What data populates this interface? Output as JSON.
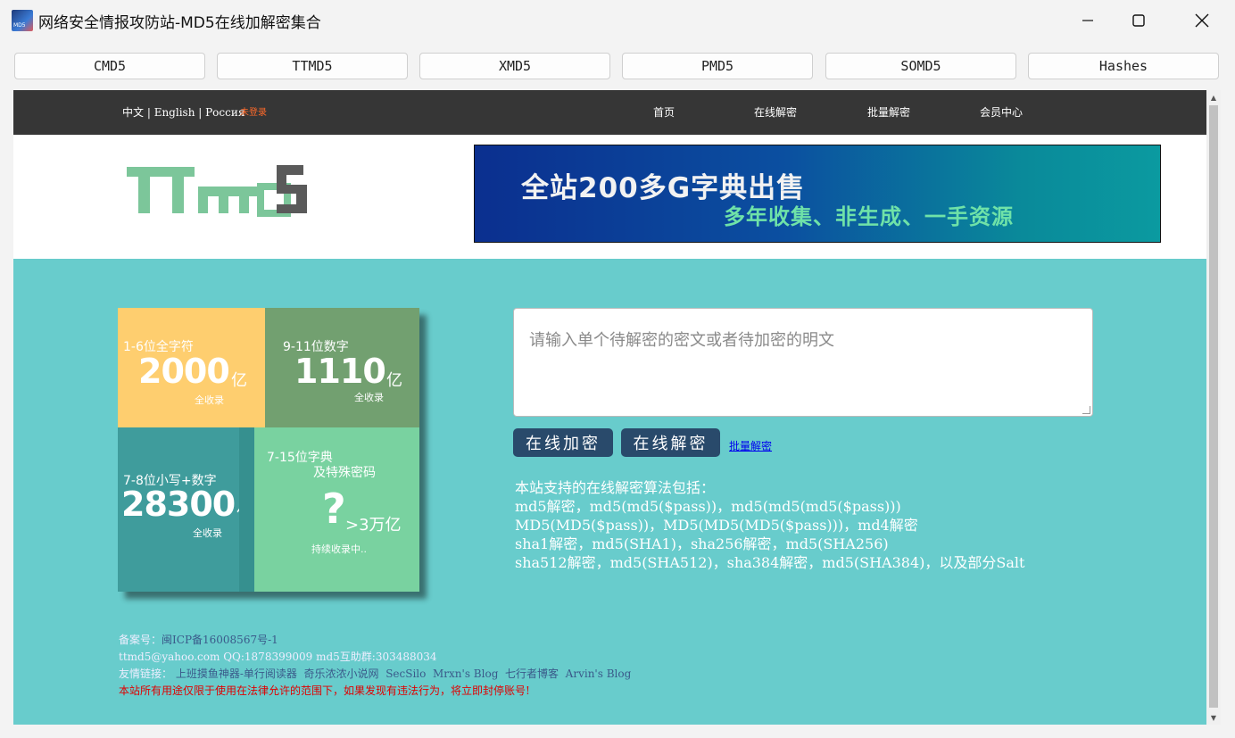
{
  "window": {
    "title": "网络安全情报攻防站-MD5在线加解密集合",
    "icon_label": "MD5"
  },
  "toolbar": {
    "buttons": [
      "CMD5",
      "TTMD5",
      "XMD5",
      "PMD5",
      "SOMD5",
      "Hashes"
    ]
  },
  "site": {
    "nav": {
      "lang_cn": "中文",
      "lang_en": "English",
      "lang_ru": "Россия",
      "login": "未登录",
      "items": [
        "首页",
        "在线解密",
        "批量解密",
        "会员中心"
      ]
    },
    "logo_text": "TTmd5",
    "banner": {
      "line1": "全站200多G字典出售",
      "line2": "多年收集、非生成、一手资源"
    },
    "stats": {
      "c1": {
        "label": "1-6位全字符",
        "value": "2000",
        "unit": "亿",
        "note": "全收录"
      },
      "c2": {
        "label": "9-11位数字",
        "value": "1110",
        "unit": "亿",
        "note": "全收录"
      },
      "c3": {
        "label": "7-8位小写+数字",
        "value": "28300",
        "unit": "亿",
        "note": "全收录"
      },
      "c4": {
        "label1": "7-15位字典",
        "label2": "及特殊密码",
        "mark": "?",
        "value": ">3万亿",
        "note": "持续收录中.."
      }
    },
    "input": {
      "placeholder": "请输入单个待解密的密文或者待加密的明文"
    },
    "actions": {
      "encrypt": "在线加密",
      "decrypt": "在线解密",
      "batch": "批量解密"
    },
    "algorithms": [
      "本站支持的在线解密算法包括：",
      "md5解密，md5(md5($pass))，md5(md5(md5($pass)))",
      "MD5(MD5($pass))，MD5(MD5(MD5($pass)))，md4解密",
      "sha1解密，md5(SHA1)，sha256解密，md5(SHA256)",
      "sha512解密，md5(SHA512)，sha384解密，md5(SHA384)，以及部分Salt"
    ],
    "footer": {
      "icp_label": "备案号：",
      "icp": "闽ICP备16008567号-1",
      "contact": "ttmd5@yahoo.com QQ:1878399009 md5互助群:303488034",
      "links_label": "友情链接：",
      "links": [
        "上班摸鱼神器-单行阅读器",
        "奇乐浓浓小说网",
        "SecSilo",
        "Mrxn's Blog",
        "七行者博客",
        "Arvin's Blog"
      ],
      "warning": "本站所有用途仅限于使用在法律允许的范围下，如果发现有违法行为，将立即封停账号!"
    }
  }
}
